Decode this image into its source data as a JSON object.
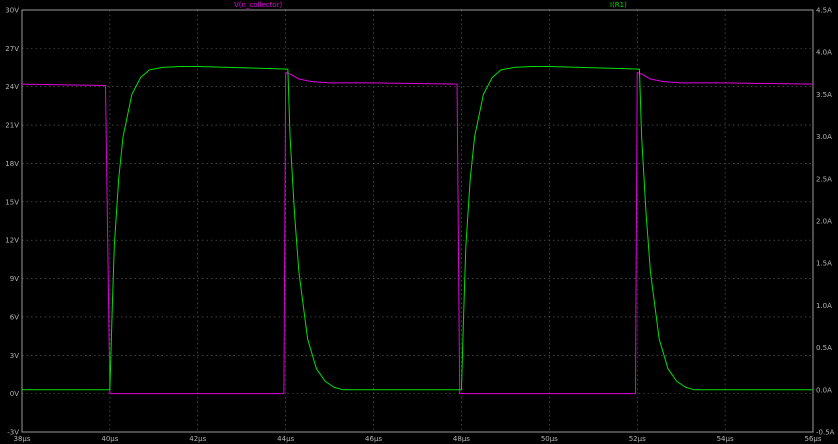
{
  "chart_data": {
    "type": "line",
    "title": "",
    "xlabel": "",
    "ylabel": "",
    "xlim": [
      38,
      56
    ],
    "ylim_left": [
      -3,
      30
    ],
    "ylim_right": [
      -0.5,
      4.5
    ],
    "grid": true,
    "x_tick_labels": [
      "38µs",
      "40µs",
      "42µs",
      "44µs",
      "46µs",
      "48µs",
      "50µs",
      "52µs",
      "54µs",
      "56µs"
    ],
    "y_left_tick_labels": [
      "30V",
      "27V",
      "24V",
      "21V",
      "18V",
      "15V",
      "12V",
      "9V",
      "6V",
      "3V",
      "0V",
      "-3V"
    ],
    "y_right_tick_labels": [
      "4.5A",
      "4.0A",
      "3.5A",
      "3.0A",
      "2.5A",
      "2.0A",
      "1.5A",
      "1.0A",
      "0.5A",
      "0.0A",
      "-0.5A"
    ],
    "series": [
      {
        "name": "V(n_collector)",
        "axis": "left",
        "color": "#e000e0",
        "x": [
          38,
          39.9,
          40.0,
          40.01,
          43.9,
          43.96,
          44.0,
          44.1,
          44.3,
          44.6,
          45.0,
          46.0,
          47.9,
          47.96,
          48.0,
          48.01,
          51.9,
          51.96,
          52.0,
          52.1,
          52.3,
          52.6,
          53.0,
          54.0,
          56.0
        ],
        "y": [
          24.2,
          24.1,
          0.0,
          0.0,
          0.0,
          0.0,
          25.1,
          25.0,
          24.6,
          24.4,
          24.3,
          24.3,
          24.2,
          0.0,
          0.0,
          0.0,
          0.0,
          0.0,
          25.1,
          25.0,
          24.6,
          24.4,
          24.3,
          24.3,
          24.2
        ]
      },
      {
        "name": "I(R1)",
        "axis": "right",
        "color": "#00e000",
        "x": [
          38,
          40.0,
          40.05,
          40.1,
          40.2,
          40.3,
          40.5,
          40.7,
          40.9,
          41.2,
          41.6,
          42.0,
          44.05,
          44.1,
          44.2,
          44.3,
          44.5,
          44.7,
          44.9,
          45.1,
          45.3,
          46.0,
          48.0,
          48.05,
          48.1,
          48.2,
          48.3,
          48.5,
          48.7,
          48.9,
          49.2,
          49.6,
          50.0,
          52.05,
          52.1,
          52.2,
          52.3,
          52.5,
          52.7,
          52.9,
          53.1,
          53.3,
          54.0,
          56.0
        ],
        "y": [
          0.0,
          0.0,
          0.9,
          1.7,
          2.5,
          3.0,
          3.5,
          3.7,
          3.79,
          3.82,
          3.83,
          3.83,
          3.8,
          3.0,
          2.1,
          1.4,
          0.6,
          0.25,
          0.1,
          0.03,
          0.0,
          0.0,
          0.0,
          0.9,
          1.7,
          2.5,
          3.0,
          3.5,
          3.7,
          3.79,
          3.82,
          3.83,
          3.83,
          3.8,
          3.0,
          2.1,
          1.4,
          0.6,
          0.25,
          0.1,
          0.03,
          0.0,
          0.0,
          0.0
        ]
      }
    ]
  }
}
